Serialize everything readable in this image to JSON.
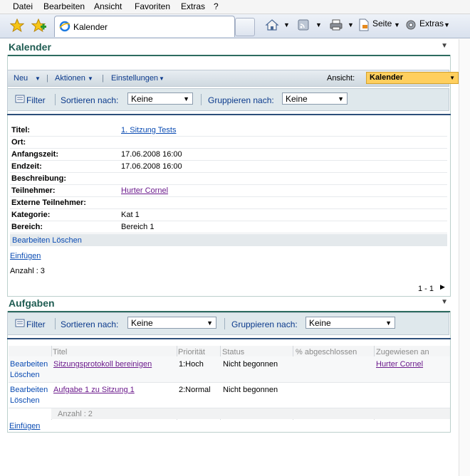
{
  "menu": [
    "Datei",
    "Bearbeiten",
    "Ansicht",
    "Favoriten",
    "Extras",
    "?"
  ],
  "browser": {
    "tab_title": "Kalender",
    "toolbar_labels": {
      "page": "Seite",
      "extras": "Extras"
    }
  },
  "calendar": {
    "title": "Kalender",
    "actions": {
      "new": "Neu",
      "actions": "Aktionen",
      "settings": "Einstellungen",
      "view_label": "Ansicht:",
      "view_value": "Kalender"
    },
    "filter": {
      "filter": "Filter",
      "sort_label": "Sortieren nach:",
      "sort_value": "Keine",
      "group_label": "Gruppieren nach:",
      "group_value": "Keine"
    },
    "fields": [
      {
        "key": "Titel:",
        "value": "1. Sitzung Tests",
        "link": true
      },
      {
        "key": "Ort:",
        "value": ""
      },
      {
        "key": "Anfangszeit:",
        "value": "17.06.2008 16:00"
      },
      {
        "key": "Endzeit:",
        "value": "17.06.2008 16:00"
      },
      {
        "key": "Beschreibung:",
        "value": ""
      },
      {
        "key": "Teilnehmer:",
        "value": "Hurter Cornel",
        "link": true
      },
      {
        "key": "Externe Teilnehmer:",
        "value": ""
      },
      {
        "key": "Kategorie:",
        "value": "Kat 1"
      },
      {
        "key": "Bereich:",
        "value": "Bereich 1"
      }
    ],
    "edit_delete": "Bearbeiten Löschen",
    "insert": "Einfügen",
    "count": "Anzahl : 3",
    "paging": "1 - 1"
  },
  "tasks": {
    "title": "Aufgaben",
    "filter": {
      "filter": "Filter",
      "sort_label": "Sortieren nach:",
      "sort_value": "Keine",
      "group_label": "Gruppieren nach:",
      "group_value": "Keine"
    },
    "columns": [
      "Titel",
      "Priorität",
      "Status",
      "% abgeschlossen",
      "Zugewiesen an"
    ],
    "rows": [
      {
        "edit": "Bearbeiten",
        "delete": "Löschen",
        "title": "Sitzungsprotokoll bereinigen",
        "priority": "1:Hoch",
        "status": "Nicht begonnen",
        "percent": "",
        "assigned": "Hurter Cornel"
      },
      {
        "edit": "Bearbeiten",
        "delete": "Löschen",
        "title": "Aufgabe 1 zu Sitzung 1",
        "priority": "2:Normal",
        "status": "Nicht begonnen",
        "percent": "",
        "assigned": ""
      }
    ],
    "count": "Anzahl : 2",
    "insert": "Einfügen"
  }
}
